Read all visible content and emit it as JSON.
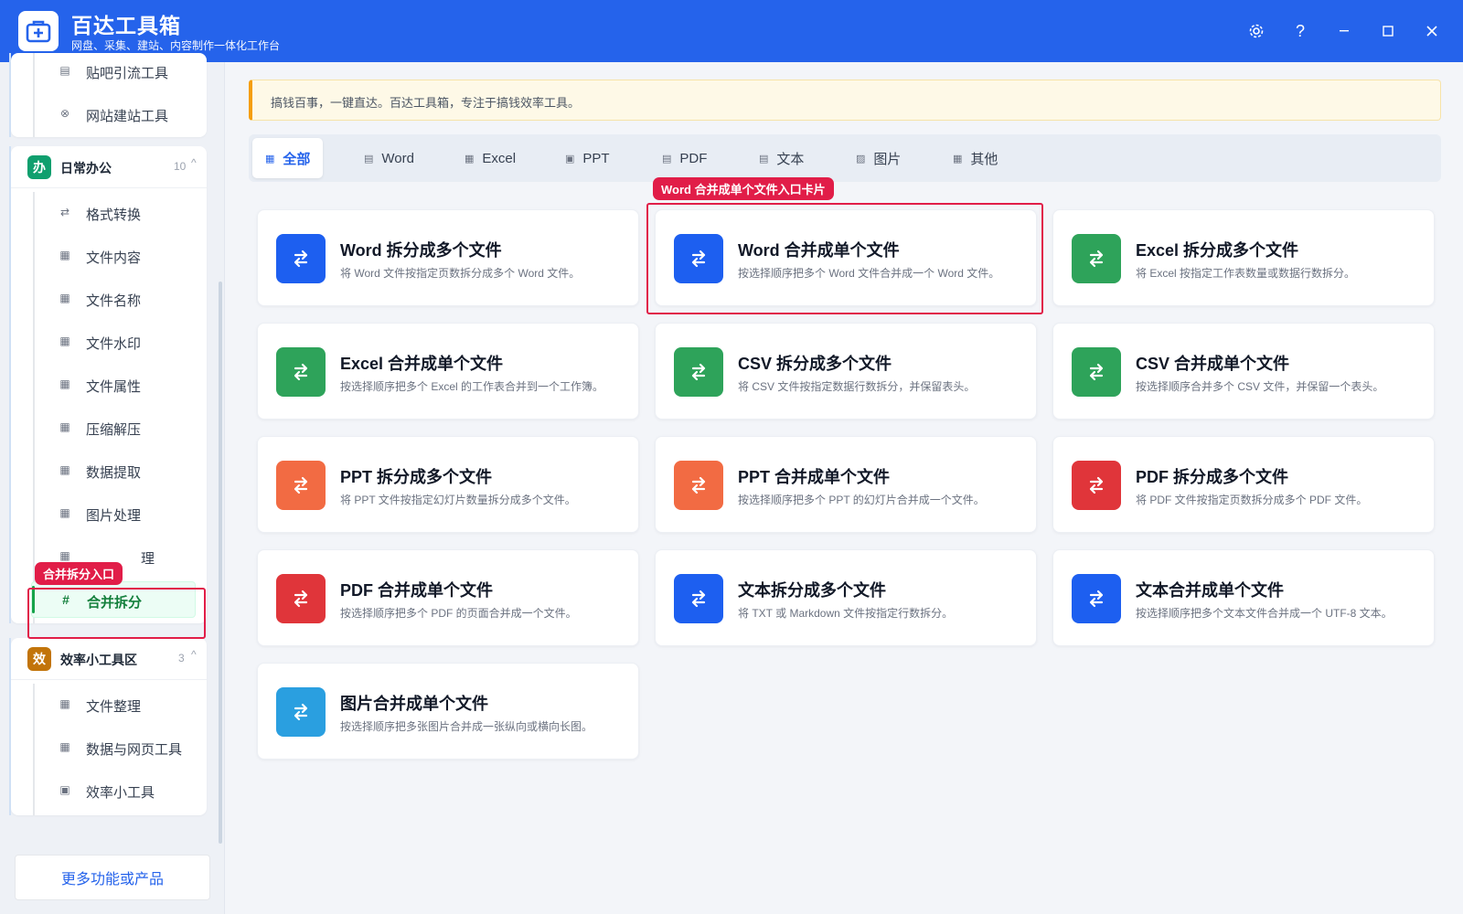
{
  "app": {
    "title": "百达工具箱",
    "subtitle": "网盘、采集、建站、内容制作一体化工作台",
    "window_buttons": [
      "settings-icon",
      "help-icon",
      "minimize-icon",
      "maximize-icon",
      "close-icon"
    ]
  },
  "sidebar": {
    "top_group_items": [
      {
        "label": "贴吧引流工具",
        "icon": "document-icon"
      },
      {
        "label": "网站建站工具",
        "icon": "globe-icon"
      }
    ],
    "office_group": {
      "badge": "办",
      "title": "日常办公",
      "count": "10",
      "color": "#0f9f6e",
      "items": [
        {
          "label": "格式转换",
          "icon": "swap-icon"
        },
        {
          "label": "文件内容",
          "icon": "grid-icon"
        },
        {
          "label": "文件名称",
          "icon": "grid-icon"
        },
        {
          "label": "文件水印",
          "icon": "grid-icon"
        },
        {
          "label": "文件属性",
          "icon": "grid-icon"
        },
        {
          "label": "压缩解压",
          "icon": "grid-icon"
        },
        {
          "label": "数据提取",
          "icon": "grid-icon"
        },
        {
          "label": "图片处理",
          "icon": "grid-icon"
        },
        {
          "label": "理",
          "icon": "grid-icon"
        },
        {
          "label": "合并拆分",
          "icon": "hash-icon"
        }
      ]
    },
    "efficiency_group": {
      "badge": "效",
      "title": "效率小工具区",
      "count": "3",
      "color": "#c2740a",
      "items": [
        {
          "label": "文件整理",
          "icon": "grid-icon"
        },
        {
          "label": "数据与网页工具",
          "icon": "grid-icon"
        },
        {
          "label": "效率小工具",
          "icon": "toolbox-icon"
        }
      ]
    },
    "more_button": "更多功能或产品",
    "annotation_merge_split": "合并拆分入口"
  },
  "notice": "搞钱百事，一键直达。百达工具箱，专注于搞钱效率工具。",
  "tabs": [
    {
      "label": "全部",
      "icon": "grid-icon",
      "active": true
    },
    {
      "label": "Word",
      "icon": "doc-icon"
    },
    {
      "label": "Excel",
      "icon": "table-icon"
    },
    {
      "label": "PPT",
      "icon": "slide-icon"
    },
    {
      "label": "PDF",
      "icon": "pdf-icon"
    },
    {
      "label": "文本",
      "icon": "text-icon"
    },
    {
      "label": "图片",
      "icon": "image-icon"
    },
    {
      "label": "其他",
      "icon": "grid-icon"
    }
  ],
  "annotation_card": "Word 合并成单个文件入口卡片",
  "cards": [
    {
      "title": "Word 拆分成多个文件",
      "desc": "将 Word 文件按指定页数拆分成多个 Word 文件。",
      "color": "#1d5ff0"
    },
    {
      "title": "Word 合并成单个文件",
      "desc": "按选择顺序把多个 Word 文件合并成一个 Word 文件。",
      "color": "#1d5ff0"
    },
    {
      "title": "Excel 拆分成多个文件",
      "desc": "将 Excel 按指定工作表数量或数据行数拆分。",
      "color": "#2ea35a"
    },
    {
      "title": "Excel 合并成单个文件",
      "desc": "按选择顺序把多个 Excel 的工作表合并到一个工作簿。",
      "color": "#2ea35a"
    },
    {
      "title": "CSV 拆分成多个文件",
      "desc": "将 CSV 文件按指定数据行数拆分，并保留表头。",
      "color": "#2ea35a"
    },
    {
      "title": "CSV 合并成单个文件",
      "desc": "按选择顺序合并多个 CSV 文件，并保留一个表头。",
      "color": "#2ea35a"
    },
    {
      "title": "PPT 拆分成多个文件",
      "desc": "将 PPT 文件按指定幻灯片数量拆分成多个文件。",
      "color": "#f26b43"
    },
    {
      "title": "PPT 合并成单个文件",
      "desc": "按选择顺序把多个 PPT 的幻灯片合并成一个文件。",
      "color": "#f26b43"
    },
    {
      "title": "PDF 拆分成多个文件",
      "desc": "将 PDF 文件按指定页数拆分成多个 PDF 文件。",
      "color": "#e0353a"
    },
    {
      "title": "PDF 合并成单个文件",
      "desc": "按选择顺序把多个 PDF 的页面合并成一个文件。",
      "color": "#e0353a"
    },
    {
      "title": "文本拆分成多个文件",
      "desc": "将 TXT 或 Markdown 文件按指定行数拆分。",
      "color": "#1d5ff0"
    },
    {
      "title": "文本合并成单个文件",
      "desc": "按选择顺序把多个文本文件合并成一个 UTF-8 文本。",
      "color": "#1d5ff0"
    },
    {
      "title": "图片合并成单个文件",
      "desc": "按选择顺序把多张图片合并成一张纵向或横向长图。",
      "color": "#2a9fe0"
    }
  ]
}
